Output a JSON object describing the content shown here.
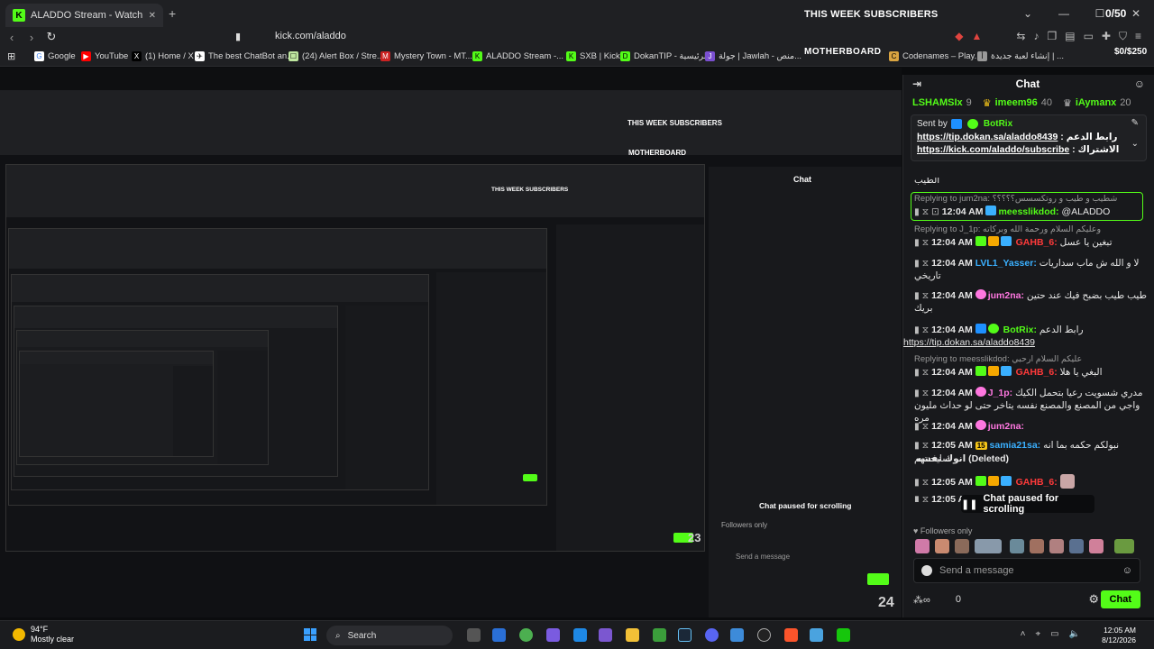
{
  "browser": {
    "tab_title": "ALADDO Stream - Watch Live o",
    "new_tab": "+",
    "url": "kick.com/aladdo",
    "bookmarks": [
      {
        "label": "Google",
        "color": "#ffffff",
        "glyph": "G"
      },
      {
        "label": "YouTube",
        "color": "#ff0000",
        "glyph": "▶"
      },
      {
        "label": "(1) Home / X",
        "color": "#ffffff",
        "glyph": "X"
      },
      {
        "label": "The best ChatBot an...",
        "color": "#ffffff",
        "glyph": "✈"
      },
      {
        "label": "(24) Alert Box / Stre...",
        "color": "#bfe7a0",
        "glyph": "☐"
      },
      {
        "label": "Mystery Town - MT...",
        "color": "#e33",
        "glyph": "M"
      },
      {
        "label": "ALADDO Stream -...",
        "color": "#53fc18",
        "glyph": "K"
      },
      {
        "label": "SXB | Kick",
        "color": "#53fc18",
        "glyph": "K"
      },
      {
        "label": "DokanTIP - الرئيسية",
        "color": "#53fc18",
        "glyph": "D"
      },
      {
        "label": "جولة | Jawlah - منص...",
        "color": "#7a4fd0",
        "glyph": "J"
      },
      {
        "label": "Codenames – Play...",
        "color": "#d9a441",
        "glyph": "C"
      },
      {
        "label": "إنشاء لعبة جديدة | ...",
        "color": "#999999",
        "glyph": "أ"
      }
    ],
    "motherboard": "MOTHERBOARD"
  },
  "overlay": {
    "subs_title": "THIS WEEK SUBSCRIBERS",
    "subs_count": "0/50",
    "goal_count": "$0/$250",
    "frame_numbers": [
      "23",
      "24"
    ]
  },
  "chat": {
    "title": "Chat",
    "gifters": [
      {
        "name": "LSHAMSIx",
        "count": "9"
      },
      {
        "name": "imeem96",
        "count": "40"
      },
      {
        "name": "iAymanx",
        "count": "20"
      }
    ],
    "pinned": {
      "sent_by": "Sent by",
      "bot": "BotRix",
      "label1": "رابط الدعم :",
      "link1": "https://tip.dokan.sa/aladdo8439",
      "label2": "الاشتراك :",
      "link2": "https://kick.com/aladdo/subscribe"
    },
    "messages": [
      {
        "type": "text",
        "text": "الطيب"
      },
      {
        "type": "reply",
        "text": "Replying to jum2na: شطيب و طيب و روتكسسس؟؟؟؟؟"
      },
      {
        "type": "msg",
        "time": "12:04 AM",
        "user": "meesslikdod:",
        "color": "#53fc18",
        "text": "@ALADDO",
        "highlight": true
      },
      {
        "type": "reply",
        "text": "Replying to J_1p: وعليكم السلام ورحمة الله وبركاته"
      },
      {
        "type": "msg",
        "time": "12:04 AM",
        "user": "GAHB_6:",
        "color": "#ff3a3a",
        "text": "تبغين يا عسل"
      },
      {
        "type": "msg",
        "time": "12:04 AM",
        "user": "LVL1_Yasser:",
        "color": "#3ab0ff",
        "text": "لا و الله ش ماب سداريات تاريخي"
      },
      {
        "type": "msg",
        "time": "12:04 AM",
        "user": "jum2na:",
        "color": "#ff77e0",
        "text": "طيب طيب بضبح فيك عند حتين بريك"
      },
      {
        "type": "msg",
        "time": "12:04 AM",
        "user": "BotRix:",
        "color": "#53fc18",
        "text": "رابط الدعم",
        "link": "https://tip.dokan.sa/aladdo8439"
      },
      {
        "type": "reply",
        "text": "Replying to meesslikdod: عليكم السلام ارحبي"
      },
      {
        "type": "msg",
        "time": "12:04 AM",
        "user": "GAHB_6:",
        "color": "#ff3a3a",
        "text": "البغي يا هلا"
      },
      {
        "type": "msg",
        "time": "12:04 AM",
        "user": "J_1p:",
        "color": "#ff77e0",
        "text": "مدري شسويت رعيا بتحمل الكيك واجي من المصنع والمصنع نفسه يتاخر حتى لو حداث مليون مره"
      },
      {
        "type": "msg",
        "time": "12:04 AM",
        "user": "jum2na:",
        "color": "#ff77e0",
        "text": ""
      },
      {
        "type": "msg",
        "time": "12:05 AM",
        "user": "samia21sa:",
        "color": "#3ab0ff",
        "text": "نبولكم حكمه بما انه سايحنتهم",
        "badge": "15"
      },
      {
        "type": "text",
        "text": "انوك نفسه (Deleted)"
      },
      {
        "type": "msg",
        "time": "12:05 AM",
        "user": "GAHB_6:",
        "color": "#ff3a3a",
        "text": ""
      },
      {
        "type": "msg",
        "time": "12:05 AM",
        "user": "",
        "color": "#ff3a3a",
        "text": ""
      }
    ],
    "paused": "Chat paused for scrolling",
    "followers_only": "Followers only",
    "input_placeholder": "Send a message",
    "points": "0",
    "send_button": "Chat"
  },
  "taskbar": {
    "temp": "94°F",
    "weather": "Mostly clear",
    "search": "Search",
    "time": "12:05 AM",
    "date": "8/12/2026"
  }
}
